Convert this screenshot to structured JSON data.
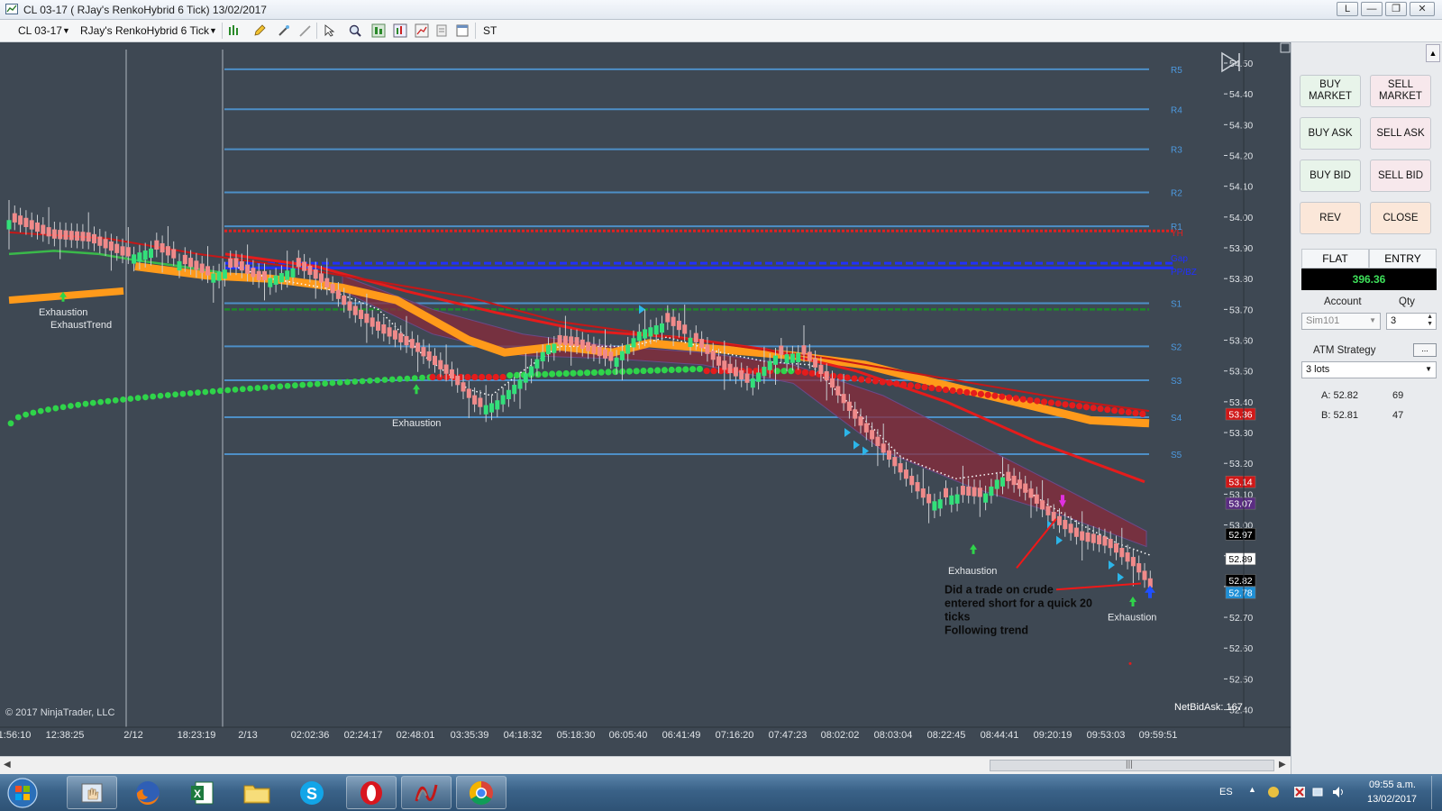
{
  "window": {
    "title": "CL 03-17 ( RJay's RenkoHybrid  6 Tick)  13/02/2017",
    "buttons": [
      "L",
      "—",
      "❐",
      "✕"
    ]
  },
  "toolbar": {
    "instrument": "CL 03-17",
    "chart_type": "RJay's RenkoHybrid  6 Tick",
    "strategy_label": "ST"
  },
  "chart": {
    "copyright": "© 2017 NinjaTrader, LLC",
    "netbidask": "NetBidAsk: 167",
    "x_labels": [
      "1:56:10",
      "12:38:25",
      "2/12",
      "18:23:19",
      "2/13",
      "02:02:36",
      "02:24:17",
      "02:48:01",
      "03:35:39",
      "04:18:32",
      "05:18:30",
      "06:05:40",
      "06:41:49",
      "07:16:20",
      "07:47:23",
      "08:02:02",
      "08:03:04",
      "08:22:45",
      "08:44:41",
      "09:20:19",
      "09:53:03",
      "09:59:51"
    ],
    "y_labels": [
      "54.50",
      "54.40",
      "54.30",
      "54.20",
      "54.10",
      "54.00",
      "53.90",
      "53.80",
      "53.70",
      "53.60",
      "53.50",
      "53.40",
      "53.30",
      "53.20",
      "53.10",
      "53.00",
      "52.90",
      "52.80",
      "52.70",
      "52.60",
      "52.50",
      "52.40"
    ],
    "pivot_levels": [
      {
        "name": "R5",
        "price": 54.48
      },
      {
        "name": "R4",
        "price": 54.35
      },
      {
        "name": "R3",
        "price": 54.22
      },
      {
        "name": "R2",
        "price": 54.08
      },
      {
        "name": "R1",
        "price": 53.97
      },
      {
        "name": "S1",
        "price": 53.72
      },
      {
        "name": "S2",
        "price": 53.58
      },
      {
        "name": "S3",
        "price": 53.47
      },
      {
        "name": "S4",
        "price": 53.35
      },
      {
        "name": "S5",
        "price": 53.23
      }
    ],
    "special_levels": [
      {
        "name": "YH",
        "price": 53.955,
        "color": "#e02020"
      },
      {
        "name": "Gap",
        "price": 53.85,
        "color": "#2030ff"
      },
      {
        "name": "PP/BZ",
        "price": 53.835,
        "color": "#2030ff"
      }
    ],
    "price_tags": [
      {
        "value": "53.36",
        "bg": "#d01818",
        "fg": "#ffffff"
      },
      {
        "value": "53.14",
        "bg": "#d01818",
        "fg": "#ffffff"
      },
      {
        "value": "53.07",
        "bg": "#5a2d82",
        "fg": "#ffffff"
      },
      {
        "value": "52.97",
        "bg": "#000000",
        "fg": "#ffffff"
      },
      {
        "value": "52.89",
        "bg": "#ffffff",
        "fg": "#000000"
      },
      {
        "value": "52.82",
        "bg": "#000000",
        "fg": "#ffffff"
      },
      {
        "value": "52.78",
        "bg": "#1e8fd6",
        "fg": "#ffffff"
      }
    ],
    "annotations": {
      "exhaustion": "Exhaustion",
      "exhaust_trend": "ExhaustTrend",
      "note_lines": [
        "Did a trade on crude",
        "entered short for a quick 20",
        "ticks",
        "Following trend"
      ]
    },
    "colors": {
      "background": "#3e4853",
      "bull_candle": "#33e07a",
      "bear_candle": "#f08a8a",
      "pivot_line": "#4d8fc7",
      "red_line": "#e41c1c",
      "orange_band": "#ff9a1a",
      "green_dots": "#2fd44a"
    }
  },
  "order_panel": {
    "buttons": [
      {
        "label": "BUY MARKET",
        "kind": "buy"
      },
      {
        "label": "SELL MARKET",
        "kind": "sell"
      },
      {
        "label": "BUY ASK",
        "kind": "buy"
      },
      {
        "label": "SELL ASK",
        "kind": "sell"
      },
      {
        "label": "BUY BID",
        "kind": "buy"
      },
      {
        "label": "SELL BID",
        "kind": "sell"
      },
      {
        "label": "REV",
        "kind": "rev"
      },
      {
        "label": "CLOSE",
        "kind": "close"
      }
    ],
    "position_label": "FLAT",
    "entry_label": "ENTRY",
    "pnl": "396.36",
    "account_label": "Account",
    "qty_label": "Qty",
    "account_value": "Sim101",
    "qty_value": "3",
    "atm_label": "ATM Strategy",
    "atm_value": "3 lots",
    "ask_label": "A: 52.82",
    "ask_size": "69",
    "bid_label": "B: 52.81",
    "bid_size": "47"
  },
  "taskbar": {
    "language": "ES",
    "time": "09:55 a.m.",
    "date": "13/02/2017",
    "apps": [
      "windows-orb",
      "hand-app",
      "firefox",
      "excel",
      "explorer",
      "skype",
      "opera",
      "ninjatrader",
      "chrome"
    ]
  }
}
